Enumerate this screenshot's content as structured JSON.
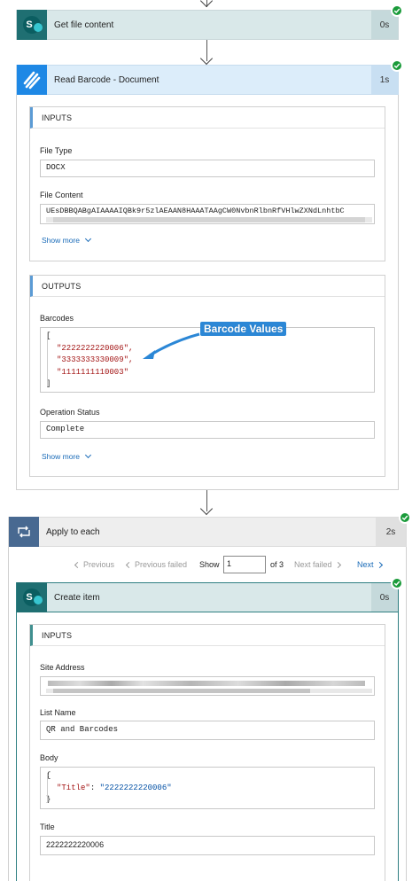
{
  "steps": {
    "get_file": {
      "title": "Get file content",
      "duration": "0s"
    },
    "read_barcode": {
      "title": "Read Barcode - Document",
      "duration": "1s"
    },
    "apply_each": {
      "title": "Apply to each",
      "duration": "2s"
    },
    "create_item": {
      "title": "Create item",
      "duration": "0s"
    }
  },
  "read_inputs": {
    "section_title": "INPUTS",
    "file_type_label": "File Type",
    "file_type_value": "DOCX",
    "file_content_label": "File Content",
    "file_content_value": "UEsDBBQABgAIAAAAIQBk9r5zlAEAAN8HAAATAAgCW0NvbnRlbnRfVHlwZXNdLnhtbC",
    "show_more": "Show more"
  },
  "read_outputs": {
    "section_title": "OUTPUTS",
    "barcodes_label": "Barcodes",
    "open_bracket": "[",
    "barcodes": [
      "\"2222222220006\",",
      "\"3333333330009\",",
      "\"1111111110003\""
    ],
    "close_bracket": "]",
    "status_label": "Operation Status",
    "status_value": "Complete",
    "show_more": "Show more"
  },
  "annotation": {
    "text": "Barcode Values"
  },
  "pager": {
    "previous": "Previous",
    "previous_failed": "Previous failed",
    "show": "Show",
    "current": "1",
    "of": "of 3",
    "next_failed": "Next failed",
    "next": "Next"
  },
  "create_inputs": {
    "section_title": "INPUTS",
    "site_label": "Site Address",
    "list_label": "List Name",
    "list_value": "QR and Barcodes",
    "body_label": "Body",
    "body_open": "{",
    "body_key": "\"Title\"",
    "body_colon": ": ",
    "body_val": "\"2222222220006\"",
    "body_close": "}",
    "title_label": "Title",
    "title_value": "2222222220006"
  },
  "colors": {
    "sharepoint": "#036c70",
    "barcode_bg": "#1e88e5",
    "success": "#1a9b3a",
    "link": "#1a6bb8",
    "callout": "#2b87d6"
  }
}
